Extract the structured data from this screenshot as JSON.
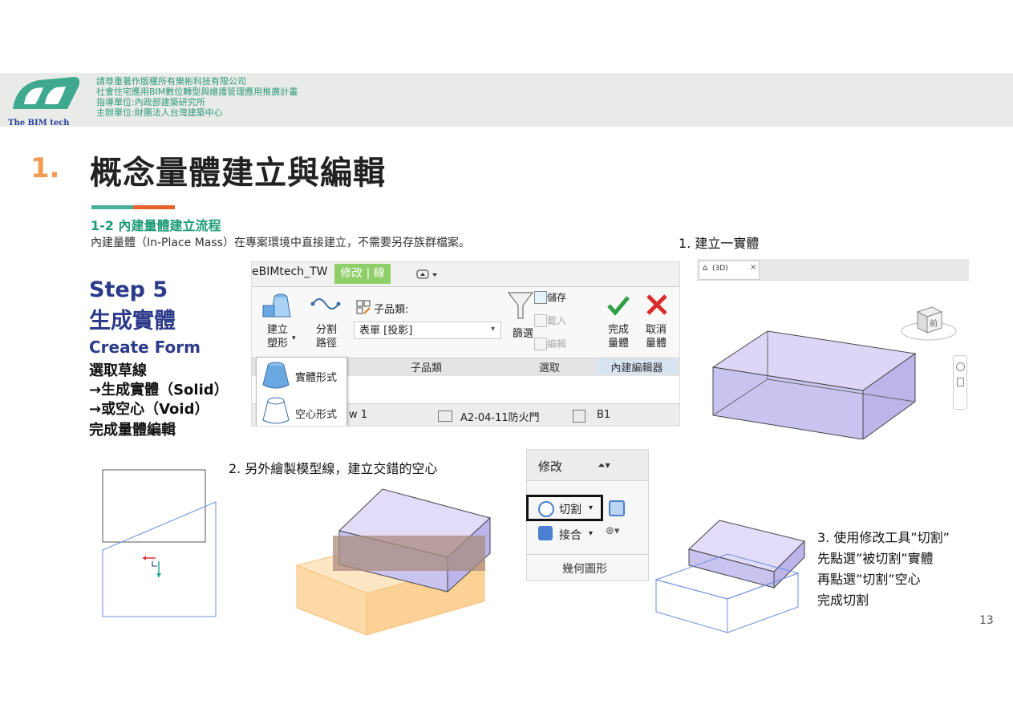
{
  "header": {
    "logo_text": "The BIM tech",
    "credits": [
      "請尊重著作版權所有樂彬科技有限公司",
      "社會住宅應用BIM數位轉型與維護管理應用推廣計畫",
      "指導單位:內政部建築研究所",
      "主辦單位:財團法人台灣建築中心"
    ]
  },
  "title": {
    "number": "1.",
    "text": "概念量體建立與編輯"
  },
  "section": {
    "title": "1-2 內建量體建立流程",
    "description": "內建量體（In-Place Mass）在專案環境中直接建立，不需要另存族群檔案。"
  },
  "step": {
    "title_line1": "Step 5",
    "title_line2": "生成實體",
    "subtitle_en": "Create Form",
    "lines": [
      "選取草線",
      "→生成實體（Solid）",
      "→或空心（Void）",
      "完成量體編輯"
    ]
  },
  "ribbon": {
    "tab_left": "eBIMtech_TW",
    "tab_active": "修改 | 線",
    "create_form": "建立\n塑形",
    "split_path": "分割\n路徑",
    "subcategory_label": "子品類:",
    "subcategory_value": "表單 [投影]",
    "filter_label": "篩選",
    "save_label": "儲存",
    "load_label": "載入",
    "edit_label": "編輯",
    "finish_label": "完成\n量體",
    "cancel_label": "取消\n量體",
    "group_subcategory": "子品類",
    "group_select": "選取",
    "group_inplace_editor": "內建編輯器",
    "menu_solid": "實體形式",
    "menu_void": "空心形式",
    "status_view": "w 1",
    "status_sheet": "A2-04-11防火門",
    "status_level": "B1"
  },
  "view3d": {
    "tab_label": "(3D)",
    "viewcube_label": "前"
  },
  "captions": {
    "step1": "1. 建立一實體",
    "step2": "2. 另外繪製模型線，建立交錯的空心",
    "step3_lines": [
      "3. 使用修改工具”切割”",
      "先點選”被切割”實體",
      "再點選”切割”空心",
      "完成切割"
    ]
  },
  "modify_panel": {
    "tab": "修改",
    "cut": "切割",
    "join": "接合",
    "group": "幾何圖形"
  },
  "page_number": "13",
  "colors": {
    "solid_fill": "#c9c3f0",
    "void_fill": "#fcd9a6",
    "edge": "#444444",
    "blue_line": "#6c8de0",
    "title_accent": "#f29a54",
    "step_blue": "#2b3a8a",
    "section_green": "#1e9a78"
  }
}
